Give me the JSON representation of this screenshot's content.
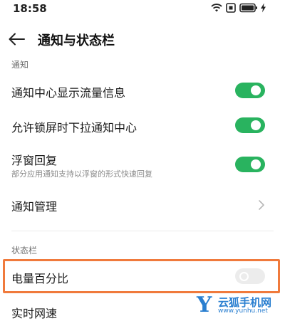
{
  "status_bar": {
    "time": "18:58",
    "icons": [
      "wifi-icon",
      "sim-icon",
      "battery-icon",
      "charging-icon"
    ]
  },
  "header": {
    "title": "通知与状态栏",
    "back_icon": "arrow-left-icon"
  },
  "sections": {
    "notifications_label": "通知",
    "status_bar_label": "状态栏"
  },
  "rows": {
    "traffic_info": {
      "label": "通知中心显示流量信息",
      "enabled": true
    },
    "lockscreen_pull": {
      "label": "允许锁屏时下拉通知中心",
      "enabled": true
    },
    "floating_reply": {
      "label": "浮窗回复",
      "sublabel": "部分应用通知支持以浮窗的形式快速回复",
      "enabled": true
    },
    "notification_mgmt": {
      "label": "通知管理",
      "icon": "chevron-right-icon"
    },
    "battery_percent": {
      "label": "电量百分比",
      "enabled": false
    },
    "realtime_speed": {
      "label": "实时网速"
    }
  },
  "colors": {
    "toggle_on": "#29b35f",
    "toggle_off": "#ececec",
    "highlight": "#f07a3c",
    "watermark": "#2a7fd0"
  },
  "watermark": {
    "logo": "Y",
    "name": "云狐手机网",
    "url": "www.yunhu.net"
  }
}
